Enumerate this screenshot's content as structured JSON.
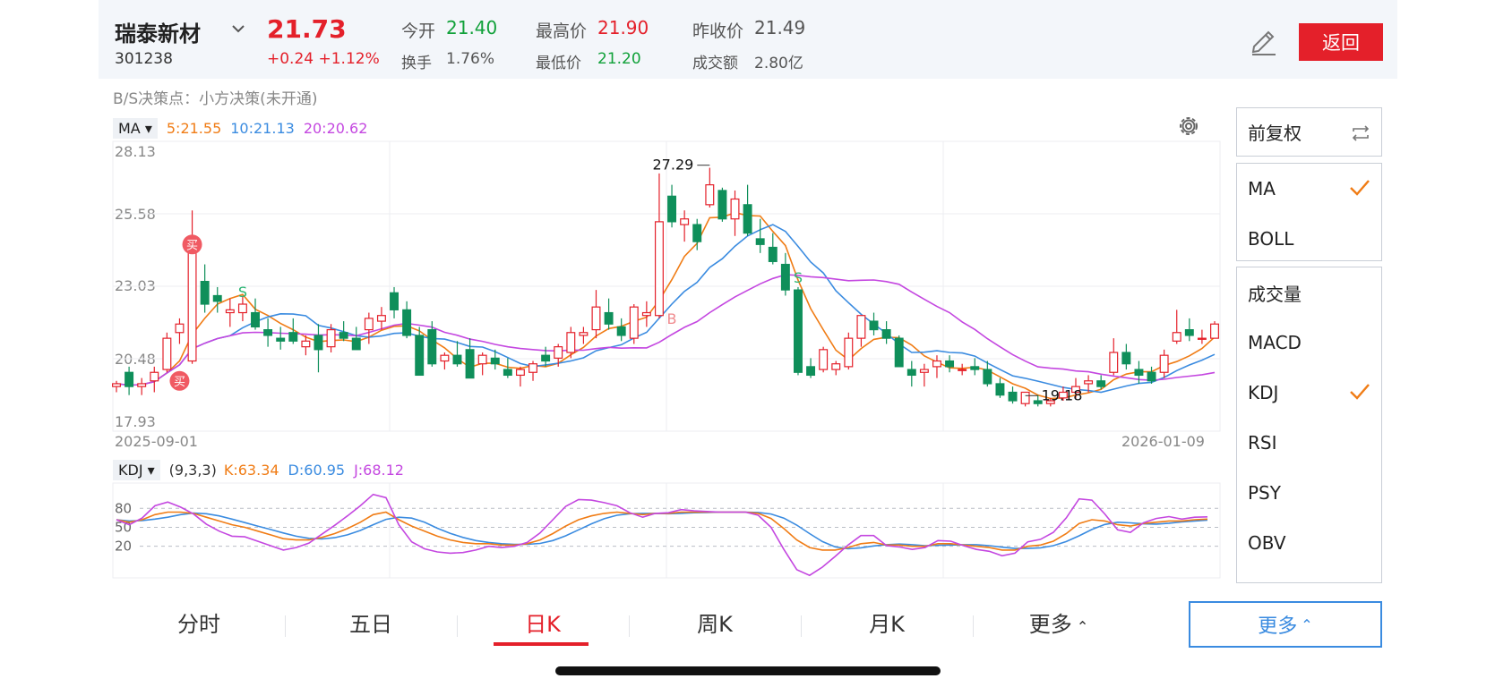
{
  "header": {
    "stock_name": "瑞泰新材",
    "stock_code": "301238",
    "price": "21.73",
    "change": "+0.24 +1.12%",
    "quotes": [
      {
        "label": "今开",
        "value": "21.40",
        "color": "#11a13a"
      },
      {
        "label": "最高价",
        "value": "21.90",
        "color": "#e4202a"
      },
      {
        "label": "昨收价",
        "value": "21.49",
        "color": "#555555"
      },
      {
        "label": "换手",
        "value": "1.76%",
        "color": "#555555"
      },
      {
        "label": "最低价",
        "value": "21.20",
        "color": "#11a13a"
      },
      {
        "label": "成交额",
        "value": "2.80亿",
        "color": "#555555"
      }
    ],
    "back_label": "返回",
    "edit_icon": "pencil-icon"
  },
  "bs_line": "B/S决策点：小方决策(未开通)",
  "ma": {
    "selector": "MA",
    "ma5": "5:21.55",
    "ma10": "10:21.13",
    "ma20": "20:20.62"
  },
  "kdj": {
    "selector": "KDJ",
    "params": "(9,3,3)",
    "k": "K:63.34",
    "d": "D:60.95",
    "j": "J:68.12"
  },
  "chart_labels": {
    "y_ticks": [
      "28.13",
      "25.58",
      "23.03",
      "20.48",
      "17.93"
    ],
    "date_start": "2025-09-01",
    "date_end": "2026-01-09",
    "high_marker": "27.29",
    "low_marker": "19.18",
    "kdj_ticks": [
      "80",
      "50",
      "20"
    ]
  },
  "colors": {
    "up": "#e4202a",
    "down": "#0f8f5a",
    "ma5": "#f07c15",
    "ma10": "#3a8be0",
    "ma20": "#c447e0"
  },
  "sidebar": {
    "adjust": "前复权",
    "main_indicators": [
      {
        "label": "MA",
        "checked": true
      },
      {
        "label": "BOLL",
        "checked": false
      }
    ],
    "sub_indicators": [
      {
        "label": "成交量",
        "checked": false
      },
      {
        "label": "MACD",
        "checked": false
      },
      {
        "label": "KDJ",
        "checked": true
      },
      {
        "label": "RSI",
        "checked": false
      },
      {
        "label": "PSY",
        "checked": false
      },
      {
        "label": "OBV",
        "checked": false
      }
    ]
  },
  "tabs": [
    "分时",
    "五日",
    "日K",
    "周K",
    "月K",
    "更多"
  ],
  "active_tab": "日K",
  "more_button": "更多",
  "chart_data": {
    "type": "candlestick",
    "y_range": [
      17.93,
      28.13
    ],
    "y_ticks": [
      28.13,
      25.58,
      23.03,
      20.48,
      17.93
    ],
    "x_range": [
      "2025-09-01",
      "2026-01-09"
    ],
    "candles": [
      {
        "o": 19.5,
        "h": 19.7,
        "l": 19.3,
        "c": 19.6
      },
      {
        "o": 20.0,
        "h": 20.2,
        "l": 19.2,
        "c": 19.5
      },
      {
        "o": 19.5,
        "h": 19.8,
        "l": 19.2,
        "c": 19.6
      },
      {
        "o": 19.7,
        "h": 20.2,
        "l": 19.3,
        "c": 20.0
      },
      {
        "o": 20.1,
        "h": 21.4,
        "l": 20.0,
        "c": 21.2
      },
      {
        "o": 21.4,
        "h": 21.9,
        "l": 21.0,
        "c": 21.7
      },
      {
        "o": 20.4,
        "h": 25.7,
        "l": 20.3,
        "c": 24.2
      },
      {
        "o": 23.2,
        "h": 23.8,
        "l": 22.1,
        "c": 22.4
      },
      {
        "o": 22.7,
        "h": 23.0,
        "l": 22.1,
        "c": 22.5
      },
      {
        "o": 22.1,
        "h": 22.6,
        "l": 21.6,
        "c": 22.2
      },
      {
        "o": 22.1,
        "h": 22.7,
        "l": 21.8,
        "c": 22.4
      },
      {
        "o": 22.1,
        "h": 22.6,
        "l": 21.5,
        "c": 21.6
      },
      {
        "o": 21.5,
        "h": 21.9,
        "l": 20.9,
        "c": 21.3
      },
      {
        "o": 21.2,
        "h": 21.6,
        "l": 20.8,
        "c": 21.1
      },
      {
        "o": 21.4,
        "h": 21.9,
        "l": 21.0,
        "c": 21.1
      },
      {
        "o": 20.9,
        "h": 21.3,
        "l": 20.6,
        "c": 21.1
      },
      {
        "o": 21.3,
        "h": 21.7,
        "l": 20.0,
        "c": 20.8
      },
      {
        "o": 20.9,
        "h": 21.7,
        "l": 20.7,
        "c": 21.5
      },
      {
        "o": 21.4,
        "h": 21.8,
        "l": 21.1,
        "c": 21.2
      },
      {
        "o": 21.2,
        "h": 21.6,
        "l": 20.8,
        "c": 20.8
      },
      {
        "o": 21.5,
        "h": 22.1,
        "l": 21.0,
        "c": 21.9
      },
      {
        "o": 21.8,
        "h": 22.3,
        "l": 21.5,
        "c": 22.0
      },
      {
        "o": 22.8,
        "h": 23.0,
        "l": 21.9,
        "c": 22.2
      },
      {
        "o": 22.2,
        "h": 22.5,
        "l": 21.2,
        "c": 21.3
      },
      {
        "o": 21.3,
        "h": 21.6,
        "l": 19.9,
        "c": 19.9
      },
      {
        "o": 21.5,
        "h": 21.8,
        "l": 20.2,
        "c": 20.3
      },
      {
        "o": 20.4,
        "h": 20.7,
        "l": 20.1,
        "c": 20.6
      },
      {
        "o": 20.6,
        "h": 21.1,
        "l": 20.2,
        "c": 20.3
      },
      {
        "o": 20.8,
        "h": 21.2,
        "l": 19.8,
        "c": 19.8
      },
      {
        "o": 20.3,
        "h": 20.7,
        "l": 19.9,
        "c": 20.6
      },
      {
        "o": 20.5,
        "h": 20.8,
        "l": 20.1,
        "c": 20.3
      },
      {
        "o": 20.1,
        "h": 20.5,
        "l": 19.8,
        "c": 19.9
      },
      {
        "o": 19.9,
        "h": 20.2,
        "l": 19.5,
        "c": 20.1
      },
      {
        "o": 20.0,
        "h": 20.4,
        "l": 19.7,
        "c": 20.3
      },
      {
        "o": 20.6,
        "h": 20.9,
        "l": 20.2,
        "c": 20.4
      },
      {
        "o": 20.5,
        "h": 21.0,
        "l": 20.2,
        "c": 20.9
      },
      {
        "o": 20.7,
        "h": 21.6,
        "l": 20.5,
        "c": 21.4
      },
      {
        "o": 21.3,
        "h": 21.6,
        "l": 21.0,
        "c": 21.4
      },
      {
        "o": 21.5,
        "h": 22.9,
        "l": 21.2,
        "c": 22.3
      },
      {
        "o": 22.1,
        "h": 22.6,
        "l": 21.5,
        "c": 21.7
      },
      {
        "o": 21.6,
        "h": 21.9,
        "l": 21.1,
        "c": 21.3
      },
      {
        "o": 21.2,
        "h": 22.4,
        "l": 21.0,
        "c": 22.3
      },
      {
        "o": 22.0,
        "h": 22.5,
        "l": 21.6,
        "c": 22.1
      },
      {
        "o": 22.0,
        "h": 27.0,
        "l": 21.9,
        "c": 25.3
      },
      {
        "o": 26.2,
        "h": 26.6,
        "l": 25.1,
        "c": 25.3
      },
      {
        "o": 25.2,
        "h": 25.7,
        "l": 24.6,
        "c": 25.4
      },
      {
        "o": 25.2,
        "h": 25.4,
        "l": 24.3,
        "c": 24.6
      },
      {
        "o": 25.9,
        "h": 27.2,
        "l": 25.8,
        "c": 26.6
      },
      {
        "o": 26.4,
        "h": 26.5,
        "l": 25.3,
        "c": 25.4
      },
      {
        "o": 25.4,
        "h": 26.4,
        "l": 24.8,
        "c": 26.1
      },
      {
        "o": 25.9,
        "h": 26.6,
        "l": 24.8,
        "c": 24.9
      },
      {
        "o": 24.7,
        "h": 25.4,
        "l": 24.2,
        "c": 24.5
      },
      {
        "o": 24.4,
        "h": 24.9,
        "l": 23.8,
        "c": 23.9
      },
      {
        "o": 23.8,
        "h": 24.2,
        "l": 22.7,
        "c": 22.9
      },
      {
        "o": 22.9,
        "h": 23.0,
        "l": 19.9,
        "c": 20.0
      },
      {
        "o": 20.2,
        "h": 20.5,
        "l": 19.8,
        "c": 19.9
      },
      {
        "o": 20.1,
        "h": 20.9,
        "l": 20.0,
        "c": 20.8
      },
      {
        "o": 20.1,
        "h": 20.4,
        "l": 19.9,
        "c": 20.3
      },
      {
        "o": 20.2,
        "h": 21.4,
        "l": 20.1,
        "c": 21.2
      },
      {
        "o": 21.2,
        "h": 22.0,
        "l": 20.9,
        "c": 22.0
      },
      {
        "o": 21.8,
        "h": 22.1,
        "l": 21.3,
        "c": 21.5
      },
      {
        "o": 21.5,
        "h": 21.8,
        "l": 21.0,
        "c": 21.2
      },
      {
        "o": 21.2,
        "h": 21.3,
        "l": 20.2,
        "c": 20.2
      },
      {
        "o": 20.1,
        "h": 20.4,
        "l": 19.5,
        "c": 19.9
      },
      {
        "o": 20.0,
        "h": 20.3,
        "l": 19.5,
        "c": 20.1
      },
      {
        "o": 20.2,
        "h": 20.6,
        "l": 19.8,
        "c": 20.4
      },
      {
        "o": 20.4,
        "h": 20.6,
        "l": 20.0,
        "c": 20.2
      },
      {
        "o": 20.1,
        "h": 20.3,
        "l": 19.9,
        "c": 20.1
      },
      {
        "o": 20.2,
        "h": 20.5,
        "l": 19.9,
        "c": 20.1
      },
      {
        "o": 20.1,
        "h": 20.4,
        "l": 19.5,
        "c": 19.6
      },
      {
        "o": 19.6,
        "h": 19.8,
        "l": 19.1,
        "c": 19.2
      },
      {
        "o": 19.3,
        "h": 19.5,
        "l": 18.9,
        "c": 19.0
      },
      {
        "o": 18.9,
        "h": 19.3,
        "l": 18.8,
        "c": 19.3
      },
      {
        "o": 19.0,
        "h": 19.2,
        "l": 18.8,
        "c": 18.9
      },
      {
        "o": 18.9,
        "h": 19.1,
        "l": 18.8,
        "c": 19.0
      },
      {
        "o": 19.1,
        "h": 19.5,
        "l": 19.0,
        "c": 19.3
      },
      {
        "o": 19.3,
        "h": 19.8,
        "l": 19.1,
        "c": 19.5
      },
      {
        "o": 19.6,
        "h": 19.9,
        "l": 19.3,
        "c": 19.7
      },
      {
        "o": 19.7,
        "h": 19.9,
        "l": 19.4,
        "c": 19.5
      },
      {
        "o": 20.0,
        "h": 21.2,
        "l": 19.9,
        "c": 20.7
      },
      {
        "o": 20.7,
        "h": 21.0,
        "l": 20.1,
        "c": 20.3
      },
      {
        "o": 20.1,
        "h": 20.4,
        "l": 19.6,
        "c": 19.9
      },
      {
        "o": 20.0,
        "h": 20.2,
        "l": 19.6,
        "c": 19.7
      },
      {
        "o": 20.0,
        "h": 20.8,
        "l": 19.8,
        "c": 20.6
      },
      {
        "o": 21.1,
        "h": 22.2,
        "l": 21.0,
        "c": 21.4
      },
      {
        "o": 21.5,
        "h": 21.9,
        "l": 21.1,
        "c": 21.3
      },
      {
        "o": 21.2,
        "h": 21.5,
        "l": 21.0,
        "c": 21.2
      },
      {
        "o": 21.2,
        "h": 21.8,
        "l": 21.2,
        "c": 21.7
      }
    ],
    "kdj": {
      "y_range": [
        -30,
        120
      ],
      "ticks": [
        80,
        50,
        20
      ],
      "k": [
        62,
        58,
        62,
        70,
        74,
        74,
        72,
        66,
        60,
        54,
        50,
        44,
        38,
        32,
        30,
        30,
        34,
        40,
        48,
        58,
        70,
        74,
        62,
        52,
        44,
        36,
        30,
        26,
        24,
        24,
        22,
        22,
        24,
        30,
        40,
        52,
        62,
        68,
        72,
        74,
        72,
        70,
        72,
        72,
        74,
        74,
        74,
        74,
        74,
        74,
        72,
        64,
        48,
        30,
        18,
        14,
        14,
        18,
        24,
        26,
        22,
        22,
        20,
        20,
        24,
        24,
        22,
        20,
        18,
        14,
        14,
        20,
        22,
        28,
        40,
        56,
        62,
        60,
        54,
        52,
        56,
        58,
        60,
        60,
        62,
        63
      ]
    },
    "markers": {
      "high": 27.29,
      "low": 19.18,
      "buy": [
        "买",
        "买"
      ],
      "sell": [
        "S",
        "S"
      ],
      "b": "B"
    }
  }
}
